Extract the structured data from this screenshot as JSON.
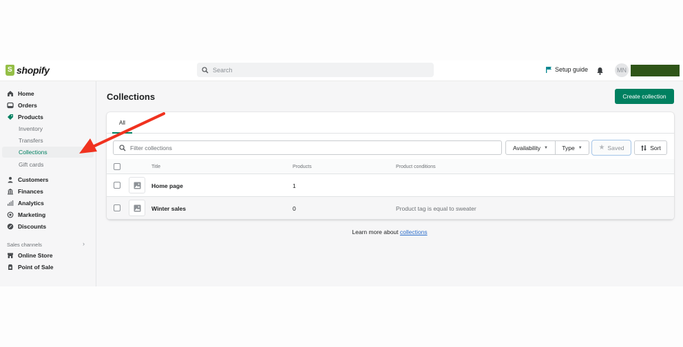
{
  "topbar": {
    "logo_text": "shopify",
    "search_placeholder": "Search",
    "setup_guide_label": "Setup guide",
    "avatar_initials": "MN",
    "store_block_color": "#2f5518"
  },
  "sidebar": {
    "items": [
      {
        "label": "Home",
        "icon": "home-icon"
      },
      {
        "label": "Orders",
        "icon": "orders-icon"
      },
      {
        "label": "Products",
        "icon": "tag-icon"
      }
    ],
    "product_subitems": [
      {
        "label": "Inventory"
      },
      {
        "label": "Transfers"
      },
      {
        "label": "Collections",
        "active": true
      },
      {
        "label": "Gift cards"
      }
    ],
    "items_2": [
      {
        "label": "Customers",
        "icon": "person-icon"
      },
      {
        "label": "Finances",
        "icon": "bank-icon"
      },
      {
        "label": "Analytics",
        "icon": "bar-chart-icon"
      },
      {
        "label": "Marketing",
        "icon": "target-icon"
      },
      {
        "label": "Discounts",
        "icon": "discount-icon"
      }
    ],
    "sales_channels_label": "Sales channels",
    "channels": [
      {
        "label": "Online Store",
        "icon": "store-icon"
      },
      {
        "label": "Point of Sale",
        "icon": "pos-icon"
      }
    ]
  },
  "main": {
    "title": "Collections",
    "create_button": "Create collection",
    "tabs": [
      {
        "label": "All",
        "active": true
      }
    ],
    "filter_placeholder": "Filter collections",
    "availability_label": "Availability",
    "type_label": "Type",
    "saved_label": "Saved",
    "sort_label": "Sort",
    "columns": [
      "Title",
      "Products",
      "Product conditions"
    ],
    "rows": [
      {
        "title": "Home page",
        "products": "1",
        "conditions": ""
      },
      {
        "title": "Winter sales",
        "products": "0",
        "conditions": "Product tag is equal to sweater"
      }
    ],
    "learn_more_prefix": "Learn more about ",
    "learn_more_link": "collections"
  },
  "colors": {
    "accent": "#008060",
    "annotation_arrow": "#f0321f",
    "link": "#2c6ecb"
  }
}
